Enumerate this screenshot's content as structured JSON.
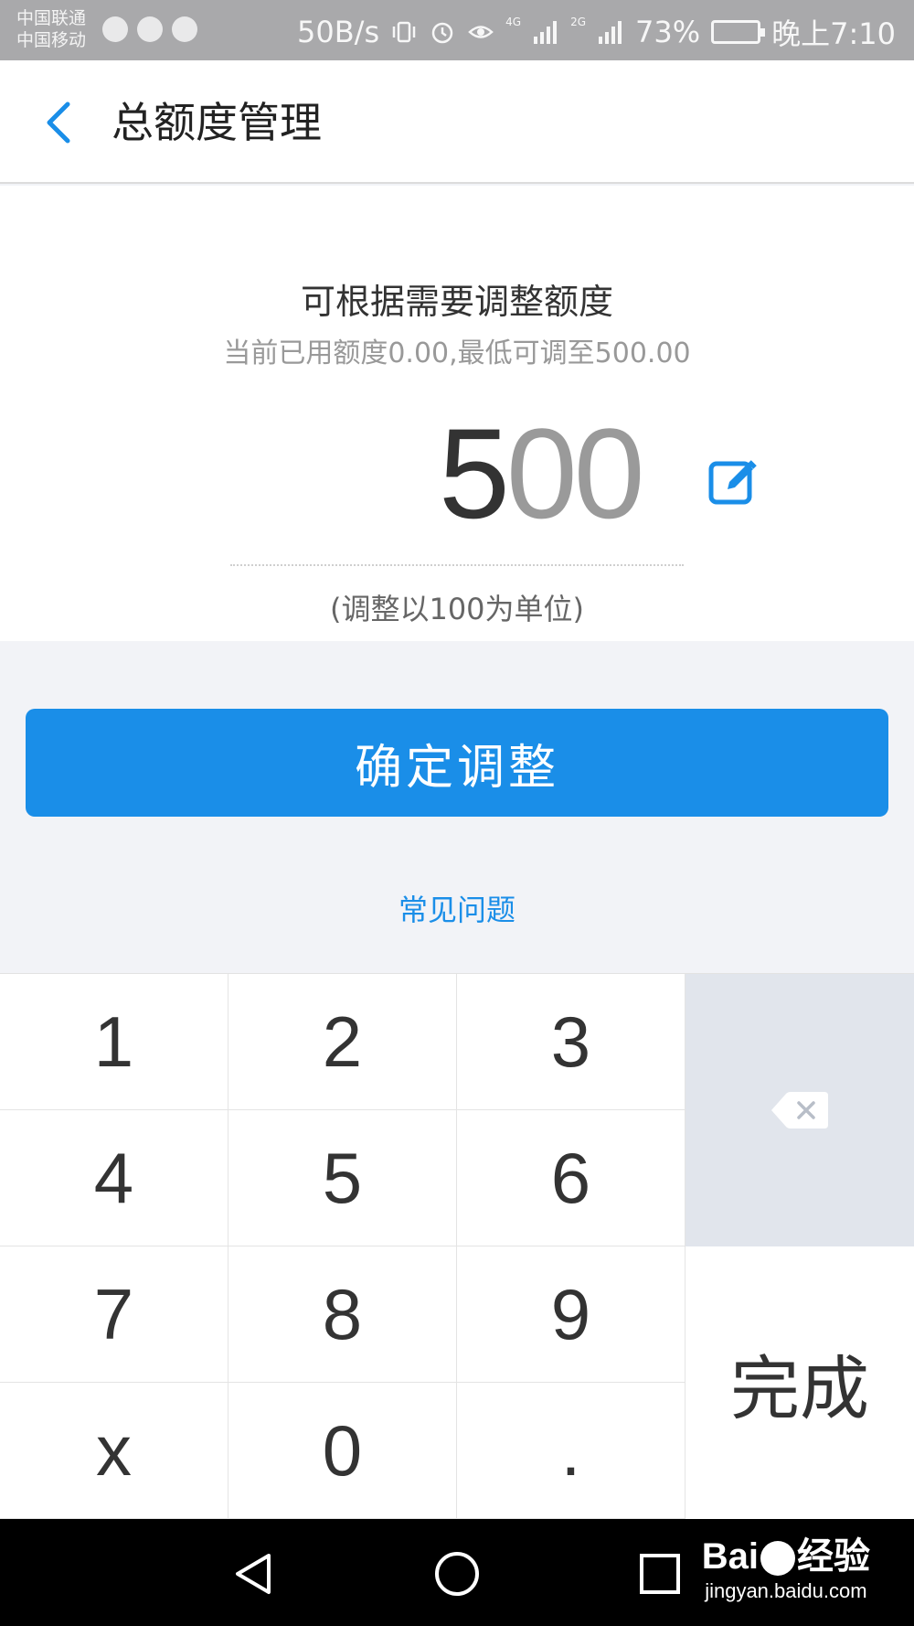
{
  "status_bar": {
    "carrier_1": "中国联通",
    "carrier_2": "中国移动",
    "net_speed": "50B/s",
    "network_1": "4G",
    "network_2": "2G",
    "battery": "73%",
    "time": "晚上7:10"
  },
  "header": {
    "title": "总额度管理"
  },
  "main": {
    "heading": "可根据需要调整额度",
    "subheading": "当前已用额度0.00,最低可调至500.00",
    "amount_typed": "5",
    "amount_hint": "00",
    "unit_note": "(调整以100为单位)"
  },
  "confirm_button": "确定调整",
  "faq_link": "常见问题",
  "keypad": {
    "keys": [
      "1",
      "2",
      "3",
      "4",
      "5",
      "6",
      "7",
      "8",
      "9",
      "x",
      "0",
      "."
    ],
    "done": "完成"
  },
  "watermark": {
    "brand_left": "Bai",
    "brand_right": "经验",
    "sub": "jingyan.baidu.com"
  },
  "colors": {
    "accent": "#1a8ee8",
    "status_bar": "#a9a9ab",
    "delete_key": "#e1e5ec"
  }
}
